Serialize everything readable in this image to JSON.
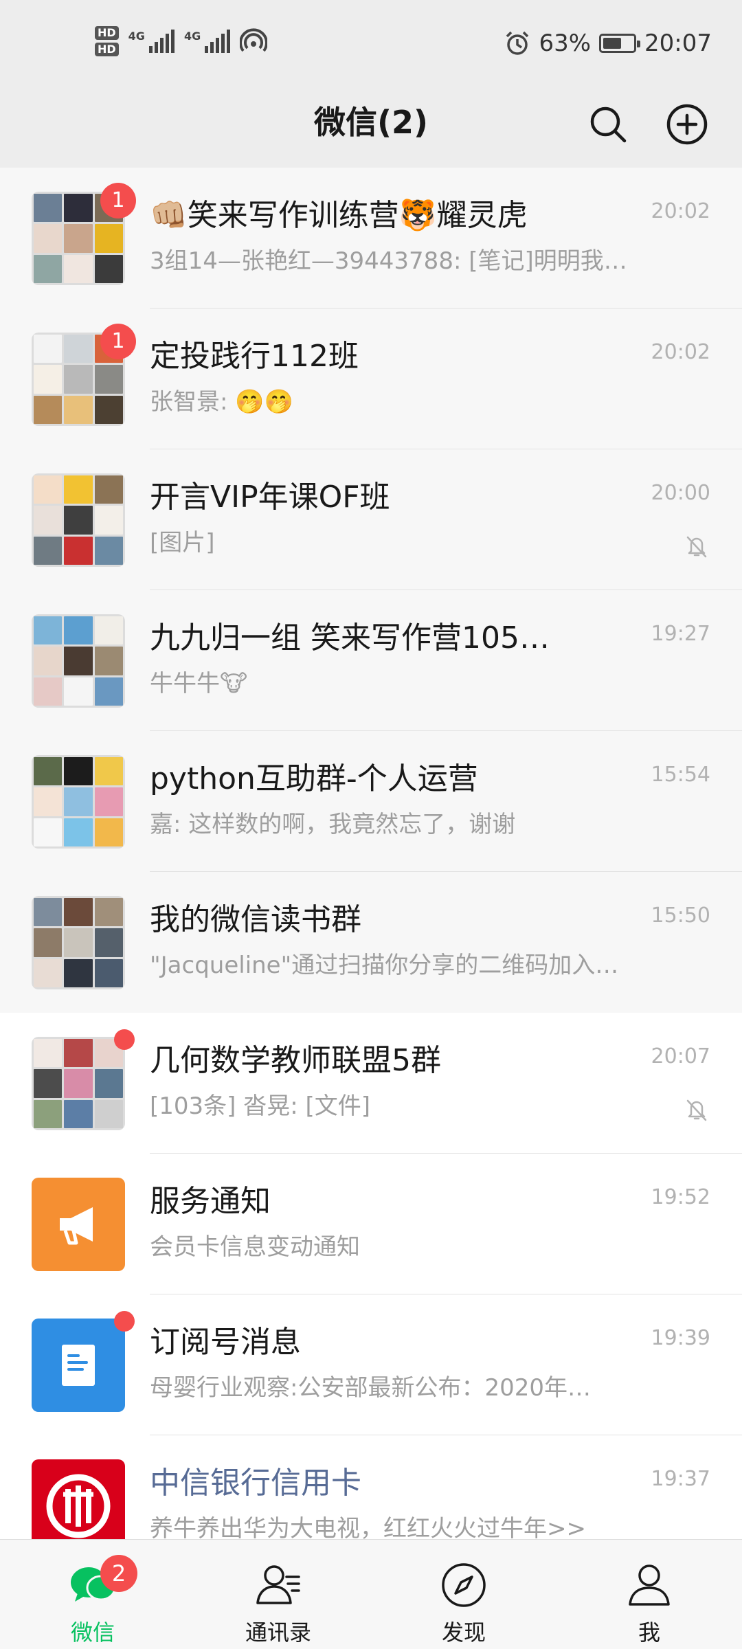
{
  "status_bar": {
    "hd1": "HD",
    "hd2": "HD",
    "net1": "4G",
    "net2": "4G",
    "battery_percent": "63%",
    "battery_level": 0.63,
    "time": "20:07",
    "icons": [
      "alarm-icon",
      "battery-icon",
      "hotspot-icon"
    ]
  },
  "header": {
    "title": "微信(2)",
    "search_icon": "search-icon",
    "add_icon": "plus-circle-icon"
  },
  "chats": [
    {
      "name": "👊🏼笑来写作训练营🐯耀灵虎",
      "preview": "3组14—张艳红—39443788: [笔记]明明我…",
      "time": "20:02",
      "badge": "1",
      "muted": false
    },
    {
      "name": "定投践行112班",
      "preview": "张智景: 🤭🤭",
      "time": "20:02",
      "badge": "1",
      "muted": false
    },
    {
      "name": "开言VIP年课OF班",
      "preview": "[图片]",
      "time": "20:00",
      "badge": "",
      "muted": true
    },
    {
      "name": "九九归一组 笑来写作营105…",
      "preview": "牛牛牛🐮",
      "time": "19:27",
      "badge": "",
      "muted": false
    },
    {
      "name": "python互助群-个人运营",
      "preview": "嘉: 这样数的啊，我竟然忘了，谢谢",
      "time": "15:54",
      "badge": "",
      "muted": false
    },
    {
      "name": "我的微信读书群",
      "preview": "\"Jacqueline\"通过扫描你分享的二维码加入…",
      "time": "15:50",
      "badge": "",
      "muted": false
    },
    {
      "name": "几何数学教师联盟5群",
      "preview": "[103条] 沓晃: [文件]",
      "time": "20:07",
      "badge": "dot",
      "muted": true
    },
    {
      "name": "服务通知",
      "preview": "会员卡信息变动通知",
      "time": "19:52",
      "badge": "",
      "muted": false
    },
    {
      "name": "订阅号消息",
      "preview": "母婴行业观察:公安部最新公布：2020年…",
      "time": "19:39",
      "badge": "dot",
      "muted": false
    },
    {
      "name": "中信银行信用卡",
      "preview": "养牛养出华为大电视，红红火火过牛年>>",
      "time": "19:37",
      "badge": "",
      "muted": false
    }
  ],
  "tabs": [
    {
      "label": "微信",
      "icon": "chat-bubbles-icon",
      "badge": "2",
      "active": true
    },
    {
      "label": "通讯录",
      "icon": "contacts-icon",
      "badge": "",
      "active": false
    },
    {
      "label": "发现",
      "icon": "compass-icon",
      "badge": "",
      "active": false
    },
    {
      "label": "我",
      "icon": "person-icon",
      "badge": "",
      "active": false
    }
  ],
  "colors": {
    "accent_green": "#07c160",
    "badge_red": "#f44d4d",
    "header_bg": "#ededed",
    "pinned_bg": "#f7f7f7",
    "official_name_blue": "#576b95",
    "service_orange": "#f58f32",
    "subscription_blue": "#2f8ee3",
    "citic_red": "#d8001a"
  }
}
